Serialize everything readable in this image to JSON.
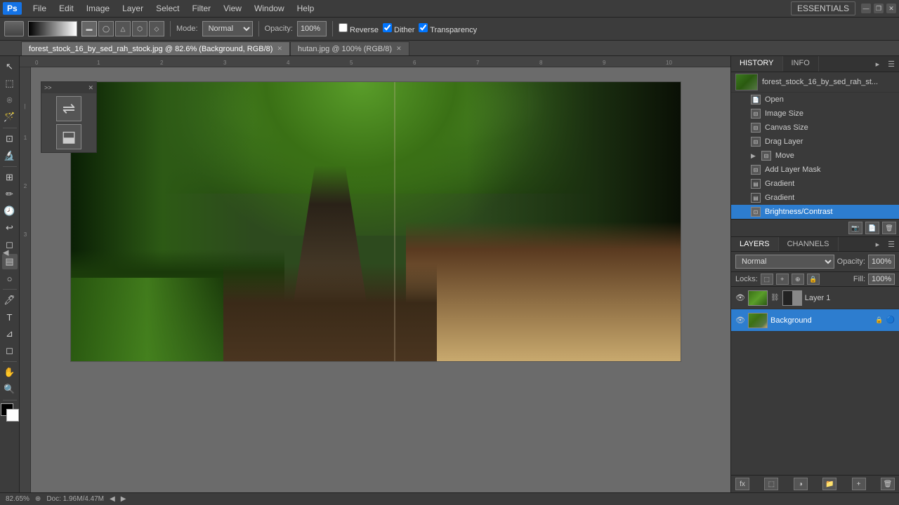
{
  "app": {
    "logo": "Ps",
    "essentials_label": "ESSENTIALS",
    "zoom_level": "82.6%"
  },
  "menubar": {
    "items": [
      "File",
      "Edit",
      "Image",
      "Layer",
      "Select",
      "Filter",
      "View",
      "Window",
      "Help"
    ]
  },
  "optionsbar": {
    "mode_label": "Mode:",
    "mode_value": "Normal",
    "opacity_label": "Opacity:",
    "opacity_value": "100%",
    "reverse_label": "Reverse",
    "dither_label": "Dither",
    "transparency_label": "Transparency"
  },
  "tabs": [
    {
      "label": "forest_stock_16_by_sed_rah_stock.jpg @ 82.6% (Background, RGB/8)",
      "active": true
    },
    {
      "label": "hutan.jpg @ 100% (RGB/8)",
      "active": false
    }
  ],
  "history": {
    "tab_label": "HISTORY",
    "info_tab_label": "INFO",
    "snapshot_name": "forest_stock_16_by_sed_rah_st...",
    "items": [
      {
        "label": "Open",
        "active": false
      },
      {
        "label": "Image Size",
        "active": false
      },
      {
        "label": "Canvas Size",
        "active": false
      },
      {
        "label": "Drag Layer",
        "active": false
      },
      {
        "label": "Move",
        "active": false
      },
      {
        "label": "Add Layer Mask",
        "active": false
      },
      {
        "label": "Gradient",
        "active": false
      },
      {
        "label": "Gradient",
        "active": false
      },
      {
        "label": "Brightness/Contrast",
        "active": true
      }
    ]
  },
  "layers": {
    "tab_label": "LAYERS",
    "channels_tab_label": "CHANNELS",
    "blend_mode": "Normal",
    "opacity_label": "Opacity:",
    "opacity_value": "100%",
    "locks_label": "Locks:",
    "fill_label": "Fill:",
    "fill_value": "100%",
    "items": [
      {
        "name": "Layer 1",
        "active": false,
        "type": "regular"
      },
      {
        "name": "Background",
        "active": true,
        "type": "background",
        "locked": true
      }
    ]
  },
  "statusbar": {
    "zoom": "82.65%",
    "doc_info": "Doc: 1.96M/4.47M"
  },
  "float_panel": {
    "title": ">>",
    "close": "✕"
  }
}
